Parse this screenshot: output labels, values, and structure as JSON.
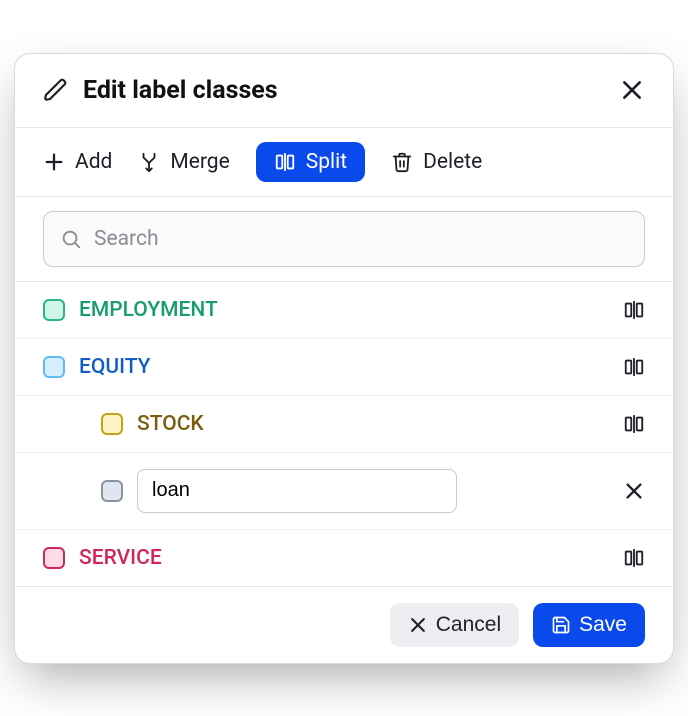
{
  "header": {
    "title": "Edit label classes"
  },
  "toolbar": {
    "add": "Add",
    "merge": "Merge",
    "split": "Split",
    "delete": "Delete"
  },
  "search": {
    "placeholder": "Search"
  },
  "rows": {
    "employment": "EMPLOYMENT",
    "equity": "EQUITY",
    "stock": "STOCK",
    "new_value": "loan",
    "service": "SERVICE"
  },
  "footer": {
    "cancel": "Cancel",
    "save": "Save"
  }
}
